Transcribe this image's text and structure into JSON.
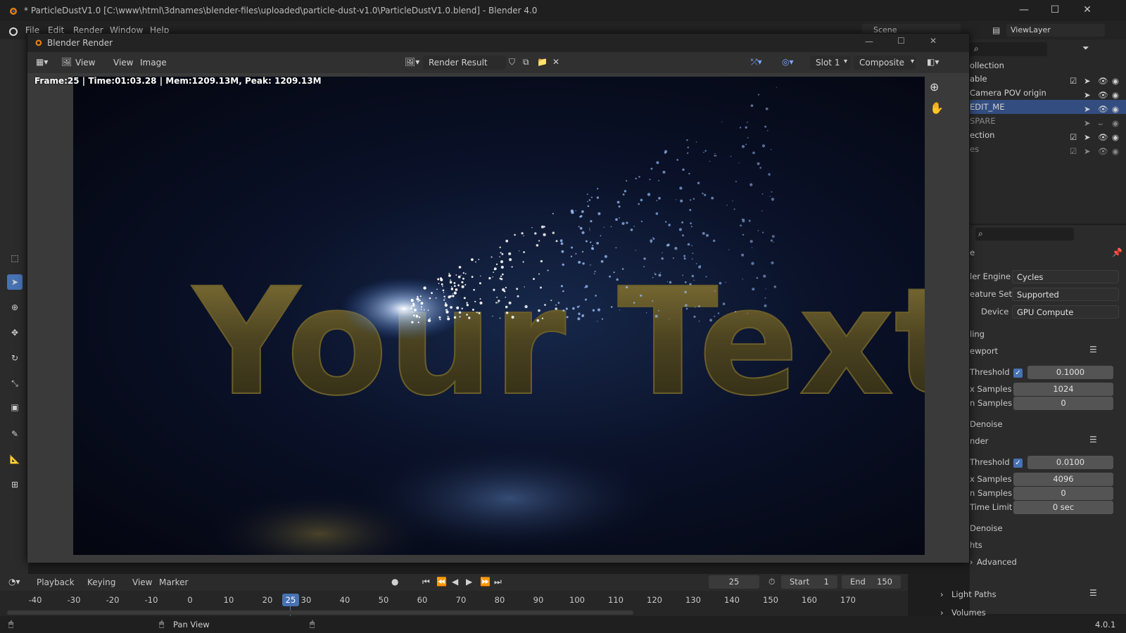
{
  "os_window": {
    "title": "* ParticleDustV1.0 [C:\\www\\html\\3dnames\\blender-files\\uploaded\\particle-dust-v1.0\\ParticleDustV1.0.blend] - Blender 4.0"
  },
  "main_header": {
    "menus": [
      "File",
      "Edit",
      "Render",
      "Window",
      "Help"
    ],
    "scene": "Scene",
    "view_layer": "ViewLayer"
  },
  "outliner": {
    "header": "ollection",
    "rows": [
      {
        "label": "able"
      },
      {
        "label": "Camera POV origin"
      },
      {
        "label": "EDIT_ME"
      },
      {
        "label": "SPARE"
      },
      {
        "label": "ection"
      },
      {
        "label": "es"
      }
    ]
  },
  "render_window": {
    "title": "Blender Render",
    "menus": [
      "View",
      "View",
      "Image"
    ],
    "image_name": "Render Result",
    "slot": "Slot 1",
    "pass": "Composite",
    "stats": "Frame:25 | Time:01:03.28 | Mem:1209.13M, Peak: 1209.13M",
    "render_text": "Your Text"
  },
  "properties": {
    "section": "e",
    "render_engine_label": "ler Engine",
    "render_engine": "Cycles",
    "feature_set_label": "eature Set",
    "feature_set": "Supported",
    "device_label": "Device",
    "device": "GPU Compute",
    "sampling_label": "ling",
    "viewport_label": "ewport",
    "vp_threshold_label": "Threshold",
    "vp_threshold": "0.1000",
    "vp_max_samples_label": "x Samples",
    "vp_max_samples": "1024",
    "vp_min_samples_label": "n Samples",
    "vp_min_samples": "0",
    "vp_denoise_label": "Denoise",
    "render_label": "nder",
    "r_threshold_label": "Threshold",
    "r_threshold": "0.0100",
    "r_max_samples_label": "x Samples",
    "r_max_samples": "4096",
    "r_min_samples_label": "n Samples",
    "r_min_samples": "0",
    "r_time_limit_label": "Time Limit",
    "r_time_limit": "0 sec",
    "r_denoise_label": "Denoise",
    "lights_label": "hts",
    "advanced_label": "Advanced",
    "light_paths_label": "Light Paths",
    "volumes_label": "Volumes"
  },
  "timeline": {
    "menus": [
      "Playback",
      "Keying",
      "View",
      "Marker"
    ],
    "current_frame": "25",
    "start_label": "Start",
    "start": "1",
    "end_label": "End",
    "end": "150",
    "ticks": [
      "-40",
      "-30",
      "-20",
      "-10",
      "0",
      "10",
      "20",
      "30",
      "40",
      "50",
      "60",
      "70",
      "80",
      "90",
      "100",
      "110",
      "120",
      "130",
      "140",
      "150",
      "160",
      "170"
    ],
    "marker": "25"
  },
  "status_bar": {
    "action": "Pan View",
    "version": "4.0.1"
  }
}
